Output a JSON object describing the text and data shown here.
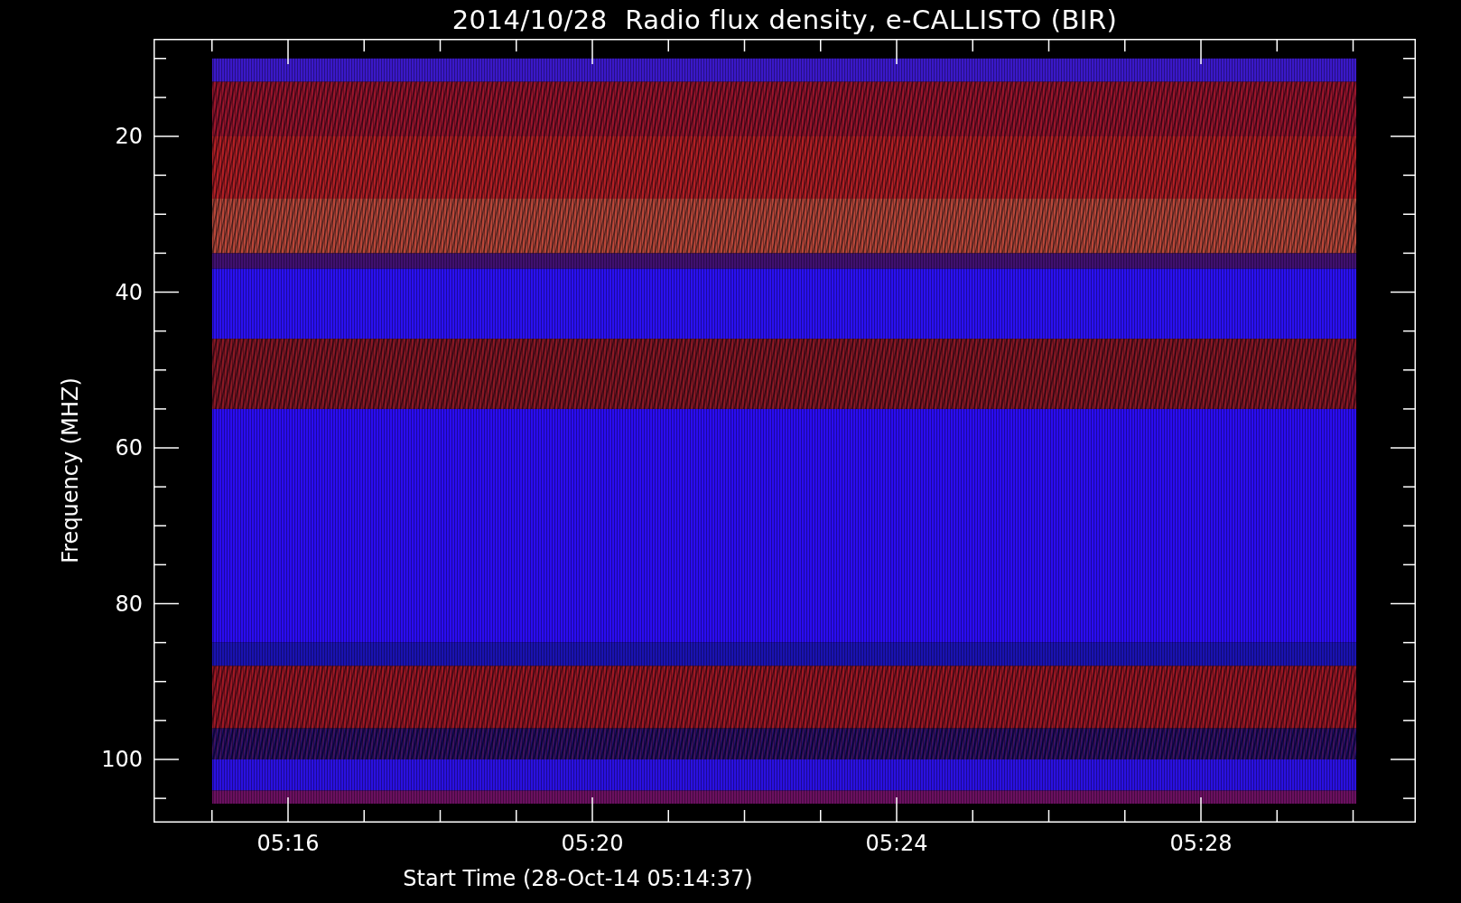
{
  "title": "2014/10/28  Radio flux density, e-CALLISTO (BIR)",
  "y_axis": {
    "label": "Frequency (MHZ)",
    "ticks": [
      "20",
      "40",
      "60",
      "80",
      "100"
    ]
  },
  "x_axis": {
    "label": "Start Time (28-Oct-14 05:14:37)",
    "ticks": [
      "05:16",
      "05:20",
      "05:24",
      "05:28"
    ]
  }
}
